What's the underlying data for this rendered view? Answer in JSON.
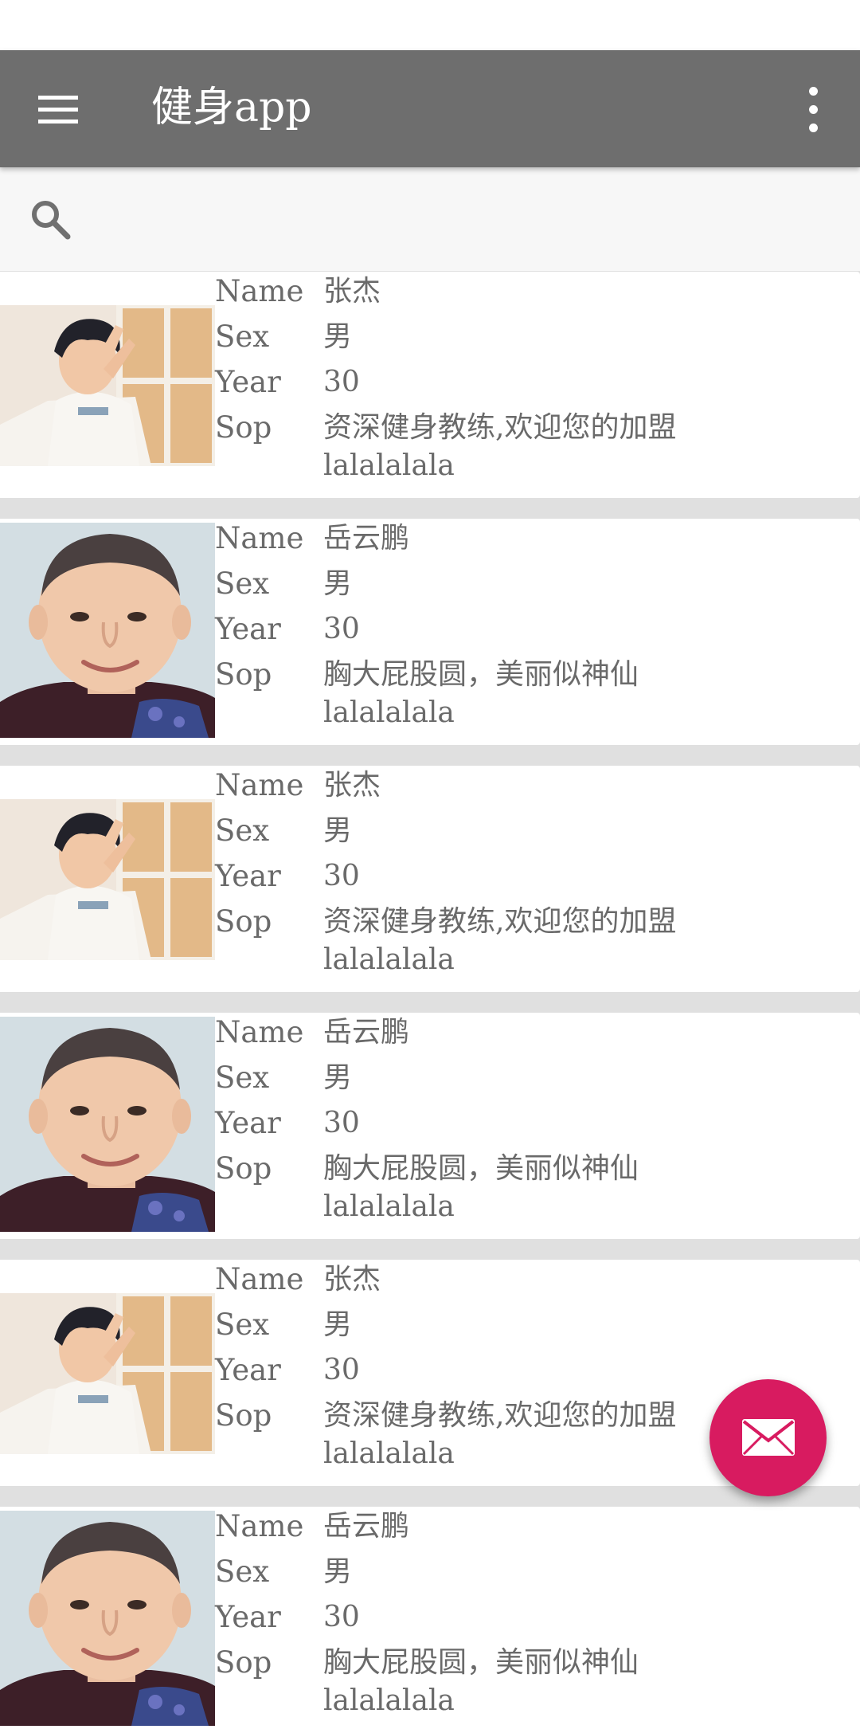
{
  "app_bar": {
    "title": "健身app",
    "menu_icon": "hamburger-menu-icon",
    "overflow_icon": "more-vert-icon",
    "background": "#6e6e6e"
  },
  "search": {
    "icon": "search-icon"
  },
  "field_labels": {
    "name": "Name",
    "sex": "Sex",
    "year": "Year",
    "sop": "Sop"
  },
  "list": [
    {
      "photo": "zhang-jie",
      "name": "张杰",
      "sex": "男",
      "year": "30",
      "sop_line1": "资深健身教练,欢迎您的加盟",
      "sop_line2": "lalalalala"
    },
    {
      "photo": "yue-yunpeng",
      "name": "岳云鹏",
      "sex": "男",
      "year": "30",
      "sop_line1": "胸大屁股圆，美丽似神仙",
      "sop_line2": "lalalalala"
    },
    {
      "photo": "zhang-jie",
      "name": "张杰",
      "sex": "男",
      "year": "30",
      "sop_line1": "资深健身教练,欢迎您的加盟",
      "sop_line2": "lalalalala"
    },
    {
      "photo": "yue-yunpeng",
      "name": "岳云鹏",
      "sex": "男",
      "year": "30",
      "sop_line1": "胸大屁股圆，美丽似神仙",
      "sop_line2": "lalalalala"
    },
    {
      "photo": "zhang-jie",
      "name": "张杰",
      "sex": "男",
      "year": "30",
      "sop_line1": "资深健身教练,欢迎您的加盟",
      "sop_line2": "lalalalala"
    },
    {
      "photo": "yue-yunpeng",
      "name": "岳云鹏",
      "sex": "男",
      "year": "30",
      "sop_line1": "胸大屁股圆，美丽似神仙",
      "sop_line2": "lalalalala"
    }
  ],
  "fab": {
    "icon": "mail-icon",
    "color": "#d81b60"
  }
}
